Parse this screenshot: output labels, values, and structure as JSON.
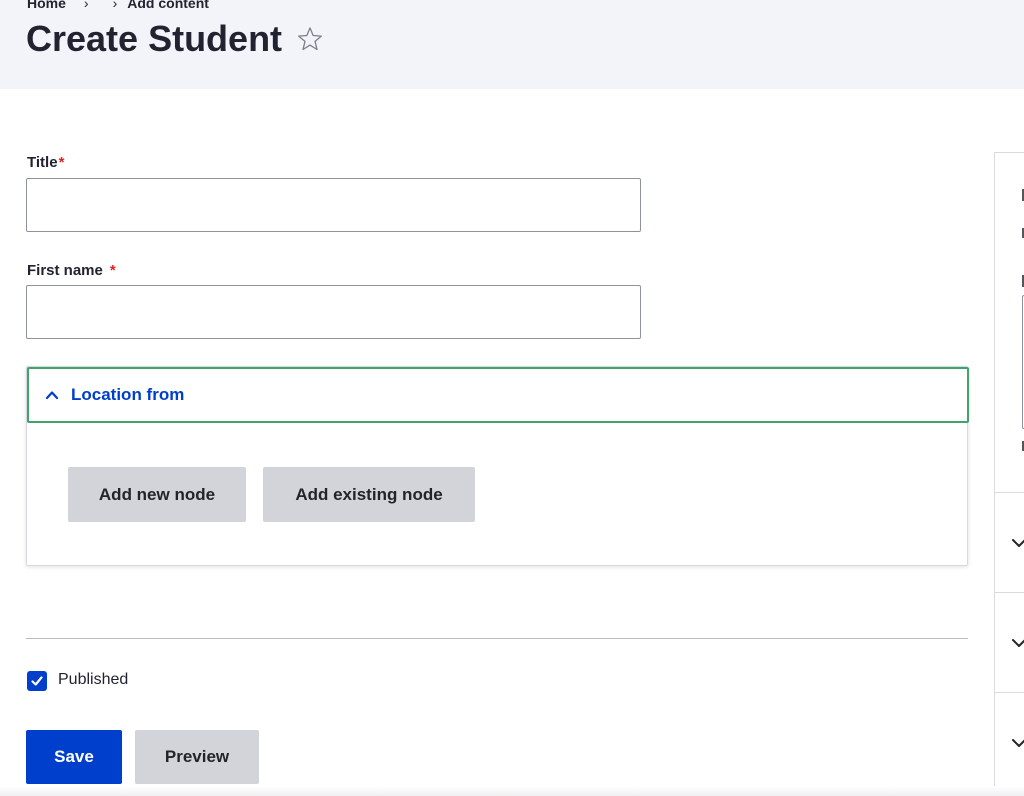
{
  "breadcrumb": {
    "items": [
      "Home",
      "",
      "Add content"
    ]
  },
  "page": {
    "title": "Create Student",
    "favorite_icon": "star-outline-icon"
  },
  "form": {
    "title_field": {
      "label": "Title",
      "required_mark": "*",
      "value": "",
      "placeholder": ""
    },
    "first_name_field": {
      "label": "First name",
      "required_mark": "*",
      "value": "",
      "placeholder": ""
    },
    "location_details": {
      "summary": "Location from",
      "expanded": true,
      "add_new_label": "Add new node",
      "add_existing_label": "Add existing node"
    },
    "published": {
      "label": "Published",
      "checked": true
    },
    "actions": {
      "save_label": "Save",
      "preview_label": "Preview"
    }
  },
  "colors": {
    "accent": "#003ecc",
    "focus": "#3fa36b",
    "required": "#dc2323",
    "header_bg": "#f3f4f9",
    "button_gray": "#d3d4d9"
  }
}
